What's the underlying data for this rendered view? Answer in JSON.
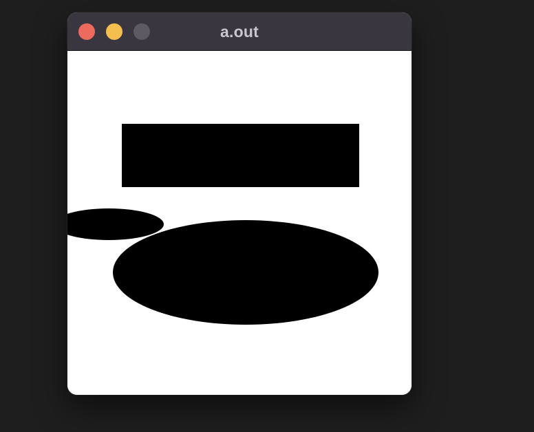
{
  "window": {
    "title": "a.out",
    "background": "#ffffff",
    "titlebar_color": "#3a3640"
  },
  "traffic_lights": [
    {
      "name": "close",
      "icon": "close-icon",
      "color": "#ed6a5e"
    },
    {
      "name": "minimize",
      "icon": "minimize-icon",
      "color": "#f5bf4f"
    },
    {
      "name": "zoom",
      "icon": "zoom-icon",
      "color": "#5e5a64"
    }
  ],
  "canvas": {
    "shapes": [
      {
        "type": "rectangle",
        "fill": "#000000"
      },
      {
        "type": "ellipse",
        "fill": "#000000"
      },
      {
        "type": "ellipse",
        "fill": "#000000"
      }
    ]
  }
}
